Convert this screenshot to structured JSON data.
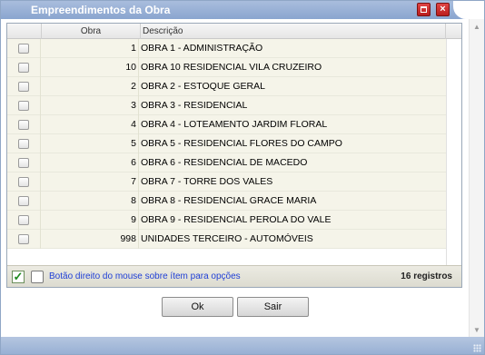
{
  "window": {
    "title": "Empreendimentos da Obra"
  },
  "grid": {
    "columns": {
      "obra": "Obra",
      "descricao": "Descrição"
    },
    "rows": [
      {
        "obra": "1",
        "descricao": "OBRA 1 - ADMINISTRAÇÃO"
      },
      {
        "obra": "10",
        "descricao": "OBRA 10 RESIDENCIAL VILA CRUZEIRO"
      },
      {
        "obra": "2",
        "descricao": "OBRA 2 - ESTOQUE GERAL"
      },
      {
        "obra": "3",
        "descricao": "OBRA 3 - RESIDENCIAL"
      },
      {
        "obra": "4",
        "descricao": "OBRA 4 - LOTEAMENTO JARDIM FLORAL"
      },
      {
        "obra": "5",
        "descricao": "OBRA 5 - RESIDENCIAL FLORES DO CAMPO"
      },
      {
        "obra": "6",
        "descricao": "OBRA 6 - RESIDENCIAL DE MACEDO"
      },
      {
        "obra": "7",
        "descricao": "OBRA 7 - TORRE DOS VALES"
      },
      {
        "obra": "8",
        "descricao": "OBRA 8 - RESIDENCIAL GRACE MARIA"
      },
      {
        "obra": "9",
        "descricao": "OBRA 9 - RESIDENCIAL PEROLA DO VALE"
      },
      {
        "obra": "998",
        "descricao": "UNIDADES TERCEIRO - AUTOMÓVEIS"
      }
    ]
  },
  "footer": {
    "hint": "Botão direito do mouse sobre ítem para opções",
    "count": "16 registros"
  },
  "buttons": {
    "ok": "Ok",
    "exit": "Sair"
  },
  "icons": {
    "maximize": "maximize-icon",
    "close": "close-icon",
    "checked": "checkmark-icon"
  },
  "colors": {
    "titlebar": "#8aa5cf",
    "close_button": "#c62828",
    "hint_text": "#1f3fd6",
    "row_bg": "#f5f4e9"
  }
}
